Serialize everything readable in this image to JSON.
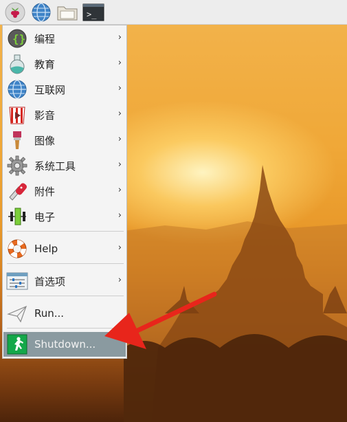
{
  "taskbar": {
    "buttons": [
      {
        "name": "raspberry-menu-button",
        "icon": "raspberry-icon"
      },
      {
        "name": "web-browser-button",
        "icon": "globe-icon"
      },
      {
        "name": "file-manager-button",
        "icon": "folder-icon"
      },
      {
        "name": "terminal-button",
        "icon": "terminal-icon"
      }
    ],
    "terminal_glyph": ">_"
  },
  "menu": {
    "items": [
      {
        "label": "编程",
        "icon": "programming-icon",
        "has_submenu": true
      },
      {
        "label": "教育",
        "icon": "education-flask-icon",
        "has_submenu": true
      },
      {
        "label": "互联网",
        "icon": "internet-globe-icon",
        "has_submenu": true
      },
      {
        "label": "影音",
        "icon": "sound-video-icon",
        "has_submenu": true
      },
      {
        "label": "图像",
        "icon": "graphics-brush-icon",
        "has_submenu": true
      },
      {
        "label": "系统工具",
        "icon": "system-tools-gear-icon",
        "has_submenu": true
      },
      {
        "label": "附件",
        "icon": "accessories-knife-icon",
        "has_submenu": true
      },
      {
        "label": "电子",
        "icon": "electronics-component-icon",
        "has_submenu": true
      },
      {
        "label": "Help",
        "icon": "help-lifebuoy-icon",
        "has_submenu": true
      },
      {
        "label": "首选项",
        "icon": "preferences-icon",
        "has_submenu": true
      },
      {
        "label": "Run...",
        "icon": "run-paper-plane-icon",
        "has_submenu": false
      },
      {
        "label": "Shutdown...",
        "icon": "shutdown-exit-icon",
        "has_submenu": false,
        "selected": true
      }
    ],
    "arrow_glyph": "›"
  },
  "colors": {
    "menu_bg": "#f4f4f4",
    "selected_bg": "#8a9aa0",
    "annotation_arrow": "#e8251b"
  }
}
